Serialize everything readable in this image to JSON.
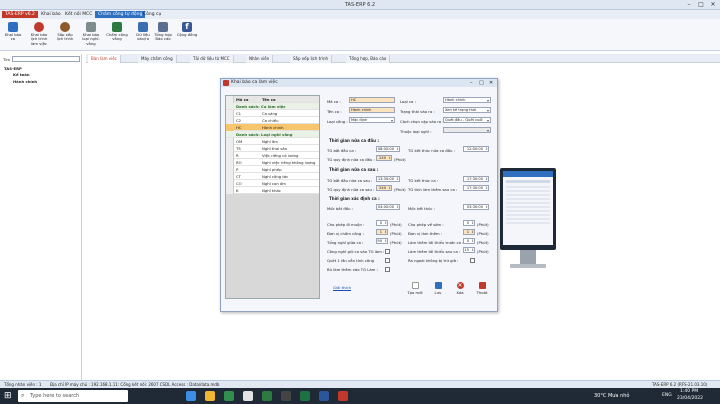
{
  "window": {
    "title": "TAS-ERP 6.2",
    "controls": [
      "–",
      "□",
      "✕"
    ]
  },
  "menu": {
    "items": [
      {
        "label": "TAS-ERP v6.2",
        "active": true
      },
      {
        "label": "Khai báo",
        "active": false
      },
      {
        "label": "Kết nối MCC",
        "active": false
      },
      {
        "label": "Chấm công tự động",
        "active": true
      },
      {
        "label": "Công cụ",
        "active": false
      }
    ]
  },
  "ribbon": {
    "buttons": [
      {
        "label": "Khai báo ca",
        "icon": "calendar-icon",
        "color": "#2f6fbf"
      },
      {
        "label": "Khai báo lịch trình làm việc",
        "icon": "schedule-icon",
        "color": "#c0392b"
      },
      {
        "label": "Sắp xếp lịch trình",
        "icon": "people-icon",
        "color": "#8e5a2b"
      },
      {
        "label": "Khai báo loại nghỉ-vắng",
        "icon": "document-icon",
        "color": "#7f8c8d"
      },
      {
        "label": "Chấm công vắng",
        "icon": "pen-icon",
        "color": "#2c7a3f"
      },
      {
        "label": "Dữ liệu vào/ra",
        "icon": "data-icon",
        "color": "#3a6fb0"
      },
      {
        "label": "Tổng hợp Báo cáo",
        "icon": "report-icon",
        "color": "#5a6f8f"
      },
      {
        "label": "Cộng đồng",
        "icon": "facebook-icon",
        "color": "#3b5998"
      }
    ]
  },
  "sidebar": {
    "search_label": "Tìm",
    "tree": [
      {
        "label": "TAS-ERP",
        "level": 0
      },
      {
        "label": "Kế toán",
        "level": 1
      },
      {
        "label": "Hành chính",
        "level": 1
      }
    ]
  },
  "tabs": [
    {
      "label": "Bàn làm việc",
      "active": true
    },
    {
      "label": "Máy chấm công",
      "active": false
    },
    {
      "label": "Tải dữ liệu từ MCC",
      "active": false
    },
    {
      "label": "Nhân viên",
      "active": false
    },
    {
      "label": "Sắp xếp lịch trình",
      "active": false
    },
    {
      "label": "Tổng hợp, Báo cáo",
      "active": false
    }
  ],
  "dialog": {
    "title": "Khai báo ca làm việc",
    "list": {
      "headers": [
        "Mã ca",
        "Tên ca"
      ],
      "rows": [
        {
          "type": "group",
          "code": "Danh sách: Ca làm việc",
          "name": ""
        },
        {
          "type": "row",
          "code": "C1",
          "name": "Ca sáng"
        },
        {
          "type": "row",
          "code": "C2",
          "name": "Ca chiều"
        },
        {
          "type": "sel",
          "code": "HC",
          "name": "Hành chính"
        },
        {
          "type": "group",
          "code": "Danh sách: Loại nghỉ vắng",
          "name": ""
        },
        {
          "type": "row",
          "code": "OM",
          "name": "Nghỉ ốm"
        },
        {
          "type": "row",
          "code": "TS",
          "name": "Nghỉ thai sản"
        },
        {
          "type": "row",
          "code": "R",
          "name": "Việc riêng có lương"
        },
        {
          "type": "row",
          "code": "RO",
          "name": "Nghỉ việc riêng không lương"
        },
        {
          "type": "row",
          "code": "P",
          "name": "Nghỉ phép"
        },
        {
          "type": "row",
          "code": "CT",
          "name": "Nghỉ công tác"
        },
        {
          "type": "row",
          "code": "CO",
          "name": "Nghỉ con ốm"
        },
        {
          "type": "row",
          "code": "K",
          "name": "Nghỉ khác"
        }
      ]
    },
    "form": {
      "ma_ca_label": "Mã ca :",
      "ma_ca_value": "HC",
      "ten_ca_label": "Tên ca :",
      "ten_ca_value": "Hành chính",
      "loai_cong_label": "Loại công :",
      "loai_cong_value": "Mặc định",
      "loai_ca_label": "Loại ca :",
      "loai_ca_value": "Hành chính",
      "trang_thai_label": "Trạng thái vào ra :",
      "trang_thai_value": "Xen kẽ trạng thái",
      "cach_chon_label": "Cách chọn cặp vào ra :",
      "cach_chon_value": "Quét đầu - Quét cuối",
      "thuoc_loai_label": "Thuộc loại nghỉ :",
      "thuoc_loai_value": "",
      "sec1": "Thời gian nửa ca đầu :",
      "tg_bat_dau_1_label": "TG bắt đầu ca :",
      "tg_bat_dau_1": "08:00:00",
      "tg_ket_thuc_1_label": "TG kết thúc nửa ca đầu :",
      "tg_ket_thuc_1": "12:00:00",
      "tg_quy_dinh_1_label": "TG quy định nửa ca đầu :",
      "tg_quy_dinh_1": "240",
      "phut": "(Phút)",
      "sec2": "Thời gian nửa ca sau :",
      "tg_bat_dau_2_label": "TG bắt đầu nửa ca sau :",
      "tg_bat_dau_2": "13:30:00",
      "tg_ket_thuc_2_label": "TG kết thúc ca :",
      "tg_ket_thuc_2": "17:30:00",
      "tg_quy_dinh_2_label": "TG quy định nửa ca sau :",
      "tg_quy_dinh_2": "240",
      "tg_tinh_lam_them_label": "TG tính làm thêm sau ca :",
      "tg_tinh_lam_them": "17:30:00",
      "sec3": "Thời gian xác định ca :",
      "moc_bat_dau_label": "Mốc bắt đầu :",
      "moc_bat_dau": "04:00:00",
      "moc_ket_thuc_label": "Mốc kết thúc :",
      "moc_ket_thuc": "03:30:00",
      "cho_phep_muon_label": "Cho phép đi muộn :",
      "cho_phep_muon": "0",
      "cho_phep_som_label": "Cho phép về sớm :",
      "cho_phep_som": "0",
      "don_vi_cham_label": "Đơn vị chấm công :",
      "don_vi_cham": "1",
      "don_vi_lam_them_label": "Đơn vị làm thêm :",
      "don_vi_lam_them": "1",
      "tong_nghi_label": "Tổng nghỉ giữa ca :",
      "tong_nghi": "90",
      "lam_them_truoc_label": "Làm thêm tối thiểu trước ca :",
      "lam_them_truoc": "0",
      "cong_nghi_giu_label": "Công nghỉ giữ ca vào TG làm :",
      "lam_them_sau_label": "Làm thêm tối thiểu sau ca :",
      "lam_them_sau": "15",
      "quet_1_lan_label": "Quét 1 lần vẫn tính công",
      "ra_ngoai_label": "Ra ngoài không bị trừ giờ :",
      "bu_lam_them_label": "Bù làm thêm vào TG Làm :",
      "help_link": "Giải thích"
    },
    "actions": [
      {
        "label": "Tạo mới",
        "icon": "new-icon",
        "color": "#e9e9e9"
      },
      {
        "label": "Lưu",
        "icon": "save-icon",
        "color": "#2f6fbf"
      },
      {
        "label": "Xóa",
        "icon": "delete-icon",
        "color": "#c0392b"
      },
      {
        "label": "Thoát",
        "icon": "exit-icon",
        "color": "#c0392b"
      }
    ]
  },
  "status": {
    "left": "Tổng nhân viên : 1",
    "middle": "Địa chỉ IP máy chủ : 192.168.1.11: Cổng kết nối: 2607   CSDL Access : Data/data.mdb",
    "right": "TAS-ERP 6.2 (RFS-21.03.10)"
  },
  "taskbar": {
    "search_placeholder": "Type here to search",
    "weather": "30°C  Mưa nhỏ",
    "lang": "ENG",
    "time": "1:40 PM",
    "date": "23/04/2022"
  },
  "colors": {
    "accent": "#2f6fbf",
    "selected": "#f7c56b",
    "highlight_input": "#fbe3c0"
  }
}
